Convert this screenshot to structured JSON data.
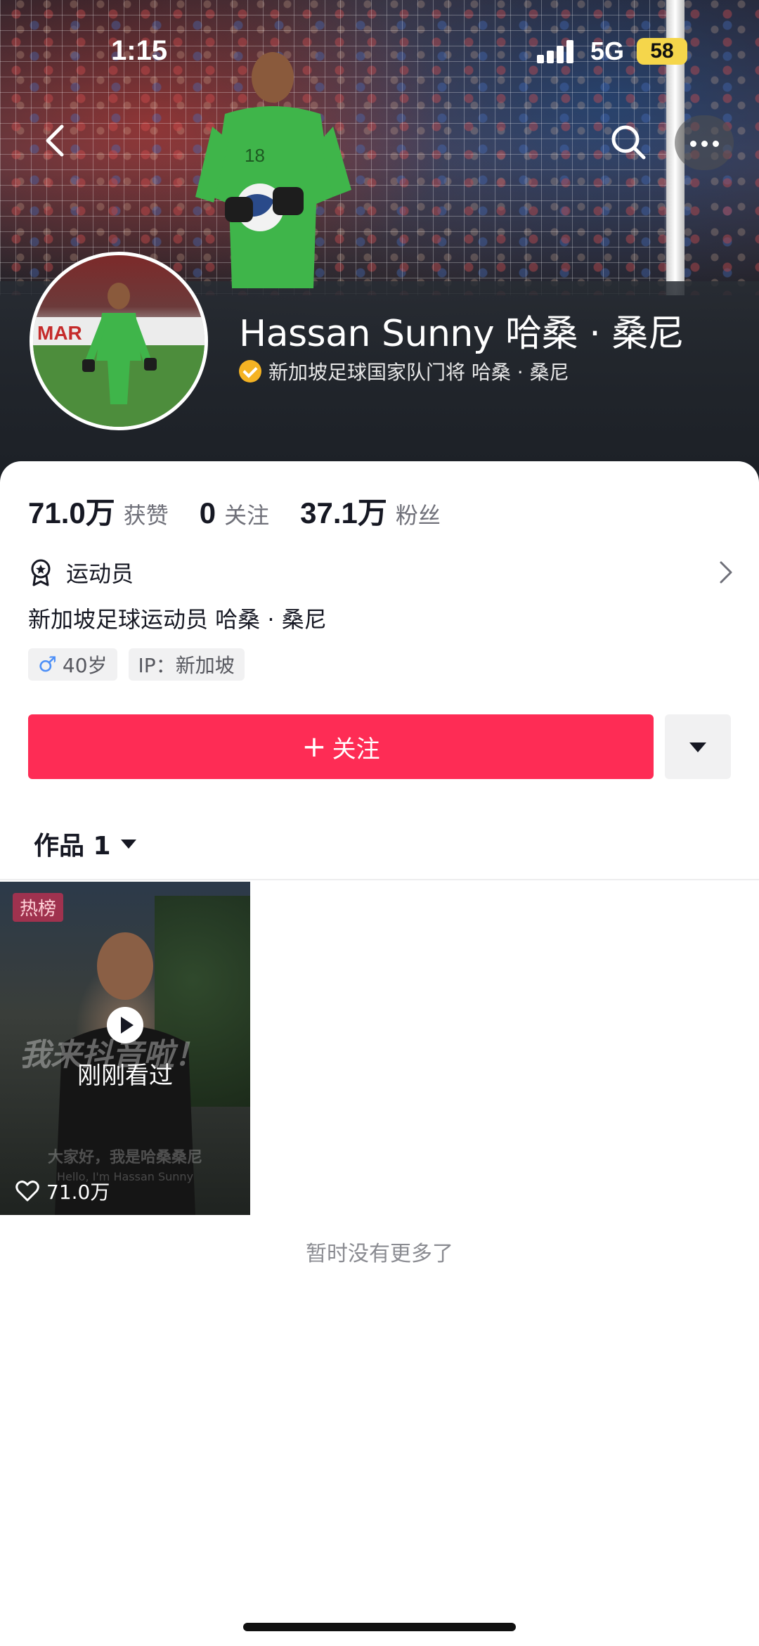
{
  "status_bar": {
    "time": "1:15",
    "network": "5G",
    "battery": "58"
  },
  "nav": {
    "back_icon": "chevron-left-icon",
    "search_icon": "search-icon",
    "more_icon": "more-dots-icon"
  },
  "profile": {
    "name": "Hassan Sunny 哈桑 · 桑尼",
    "verified_text": "新加坡足球国家队门将 哈桑 · 桑尼",
    "verified_color": "#f5b323"
  },
  "stats": [
    {
      "value": "71.0万",
      "label": "获赞"
    },
    {
      "value": "0",
      "label": "关注"
    },
    {
      "value": "37.1万",
      "label": "粉丝"
    }
  ],
  "category": {
    "label": "运动员"
  },
  "bio": "新加坡足球运动员 哈桑 · 桑尼",
  "tags": {
    "age": "40岁",
    "ip": "IP：新加坡"
  },
  "actions": {
    "follow_plus": "+",
    "follow_label": "关注",
    "follow_color": "#fe2c55"
  },
  "works": {
    "tab_label": "作品 1"
  },
  "videos": [
    {
      "badge": "热榜",
      "overlay": "我来抖音啦！",
      "status": "刚刚看过",
      "subtitle_cn": "大家好，我是哈桑桑尼",
      "subtitle_en": "Hello, I'm Hassan Sunny",
      "likes": "71.0万"
    }
  ],
  "footer": {
    "no_more": "暂时没有更多了"
  }
}
